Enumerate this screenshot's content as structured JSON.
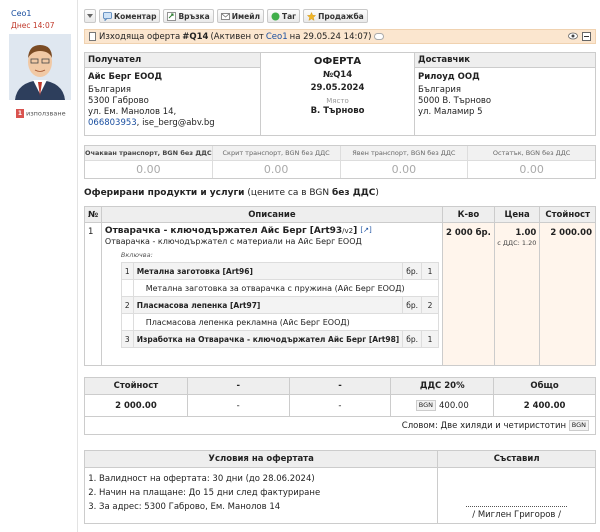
{
  "user": {
    "name": "Ceo1",
    "date": "Днес 14:07",
    "usage_count": "1",
    "usage_label": "използване"
  },
  "toolbar": {
    "comment": "Коментар",
    "link": "Връзка",
    "email": "Имейл",
    "tag": "Таг",
    "sale": "Продажба"
  },
  "header": {
    "prefix": "Изходяща оферта",
    "number": "#Q14",
    "status_open": "(Активен от",
    "author": "Ceo1",
    "status_date": "на 29.05.24 14:07)"
  },
  "recipient": {
    "title": "Получател",
    "name": "Айс Берг ЕООД",
    "country": "България",
    "city": "5300 Габрово",
    "street": "ул. Ем. Манолов 14,",
    "phone": "066803953",
    "email": ", ise_berg@abv.bg"
  },
  "offer": {
    "title": "ОФЕРТА",
    "number": "№Q14",
    "date": "29.05.2024",
    "place_label": "Място",
    "place": "В. Търново"
  },
  "supplier": {
    "title": "Доставчик",
    "name": "Рилоуд ООД",
    "country": "България",
    "city": "5000 В. Търново",
    "street": "ул. Маламир 5"
  },
  "transport": [
    {
      "label": "Очакван транспорт, BGN без ДДС",
      "value": "0.00"
    },
    {
      "label": "Скрит транспорт, BGN без ДДС",
      "value": "0.00"
    },
    {
      "label": "Явен транспорт, BGN без ДДС",
      "value": "0.00"
    },
    {
      "label": "Остатък, BGN без ДДС",
      "value": "0.00"
    }
  ],
  "products_section": {
    "bold": "Оферирани продукти и услуги",
    "rest": " (цените са в BGN ",
    "bold2": "без ДДС",
    "end": ")"
  },
  "products_table": {
    "headers": [
      "№",
      "Описание",
      "К-во",
      "Цена",
      "Стойност"
    ],
    "row": {
      "num": "1",
      "name": "Отварачка - ключодържател Айс Берг",
      "code": "[Art93",
      "version": "/v2",
      "code_end": "]",
      "desc": "Отварачка - ключодържател с материали на Айс Берг ЕООД",
      "includes_label": "Включва:",
      "qty": "2 000 бр.",
      "price": "1.00",
      "price_vat": "с ДДС: 1.20",
      "total": "2 000.00"
    },
    "includes": [
      {
        "num": "1",
        "name": "Метална заготовка [Art96]",
        "unit": "бр.",
        "qty": "1",
        "desc": "Метална заготовка за отварачка с пружина (Айс Берг ЕООД)"
      },
      {
        "num": "2",
        "name": "Пласмасова лепенка [Art97]",
        "unit": "бр.",
        "qty": "2",
        "desc": "Пласмасова лепенка рекламна (Айс Берг ЕООД)"
      },
      {
        "num": "3",
        "name": "Изработка на Отварачка - ключодържател Айс Берг [Art98]",
        "unit": "бр.",
        "qty": "1"
      }
    ]
  },
  "totals": {
    "headers": [
      "Стойност",
      "-",
      "-",
      "ДДС 20%",
      "Общо"
    ],
    "values": [
      "2 000.00",
      "-",
      "-",
      "400.00",
      "2 400.00"
    ],
    "currency": "BGN",
    "words": "Словом: Две хиляди и четиристотин"
  },
  "conditions": {
    "title": "Условия на офертата",
    "items": [
      "Валидност на офертата: 30 дни (до 28.06.2024)",
      "Начин на плащане: До 15 дни след фактуриране",
      "За адрес: 5300 Габрово, Ем. Манолов 14"
    ],
    "composed_title": "Съставил",
    "composed_by": "/ Миглен Григоров /"
  }
}
